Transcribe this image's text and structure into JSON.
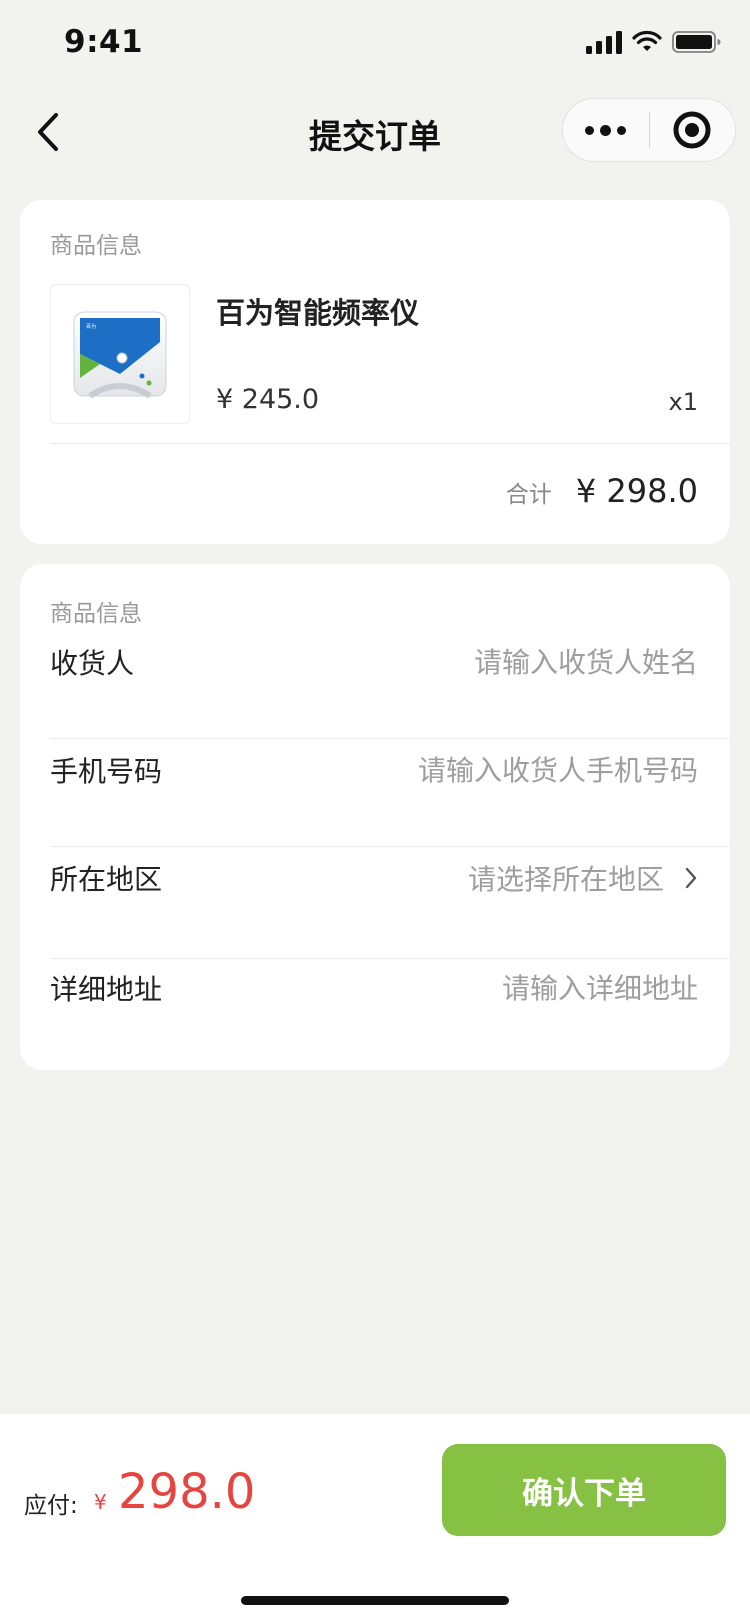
{
  "status_bar": {
    "time": "9:41"
  },
  "nav": {
    "title": "提交订单"
  },
  "product_card": {
    "section_label": "商品信息",
    "product_name": "百为智能频率仪",
    "price": "¥ 245.0",
    "quantity": "x1",
    "total_label": "合计",
    "total_value": "¥ 298.0"
  },
  "form_card": {
    "section_label": "商品信息",
    "fields": [
      {
        "label": "收货人",
        "placeholder": "请输入收货人姓名"
      },
      {
        "label": "手机号码",
        "placeholder": "请输入收货人手机号码"
      },
      {
        "label": "所在地区",
        "placeholder": "请选择所在地区"
      },
      {
        "label": "详细地址",
        "placeholder": "请输入详细地址"
      }
    ]
  },
  "bottom_bar": {
    "pay_label": "应付:",
    "currency": "¥",
    "amount": "298.0",
    "confirm_label": "确认下单"
  },
  "colors": {
    "background": "#f2f3ef",
    "accent_green": "#86c143",
    "price_red": "#e6453f"
  },
  "icons": [
    "back-icon",
    "more-icon",
    "target-icon",
    "chevron-right-icon",
    "signal-icon",
    "wifi-icon",
    "battery-icon"
  ]
}
